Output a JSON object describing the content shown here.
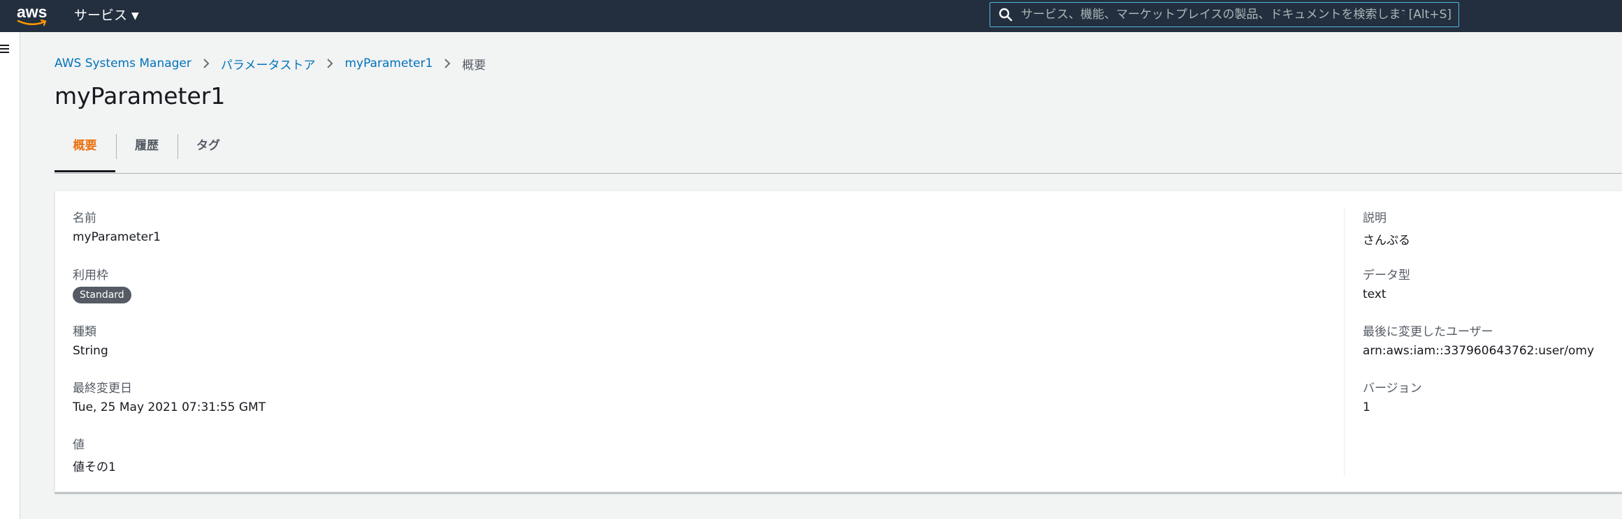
{
  "header": {
    "logo_text": "aws",
    "services_label": "サービス",
    "search": {
      "placeholder": "サービス、機能、マーケットプレイスの製品、ドキュメントを検索します",
      "shortcut": "[Alt+S]"
    }
  },
  "breadcrumb": [
    {
      "label": "AWS Systems Manager"
    },
    {
      "label": "パラメータストア"
    },
    {
      "label": "myParameter1"
    },
    {
      "label": "概要"
    }
  ],
  "page": {
    "title": "myParameter1"
  },
  "tabs": [
    {
      "label": "概要",
      "active": true
    },
    {
      "label": "履歴",
      "active": false
    },
    {
      "label": "タグ",
      "active": false
    }
  ],
  "details": {
    "left": [
      {
        "label": "名前",
        "value": "myParameter1"
      },
      {
        "label": "利用枠",
        "value": "Standard",
        "badge": true
      },
      {
        "label": "種類",
        "value": "String"
      },
      {
        "label": "最終変更日",
        "value": "Tue, 25 May 2021 07:31:55 GMT"
      },
      {
        "label": "値",
        "value": "値その1"
      }
    ],
    "right": [
      {
        "label": "説明",
        "value": "さんぷる"
      },
      {
        "label": "データ型",
        "value": "text"
      },
      {
        "label": "最後に変更したユーザー",
        "value": "arn:aws:iam::337960643762:user/omy"
      },
      {
        "label": "バージョン",
        "value": "1"
      }
    ]
  },
  "colors": {
    "nav_bg": "#232f3e",
    "link": "#0073bb",
    "tab_active": "#ec7211",
    "badge_bg": "#545b64",
    "page_bg": "#f2f3f3"
  }
}
